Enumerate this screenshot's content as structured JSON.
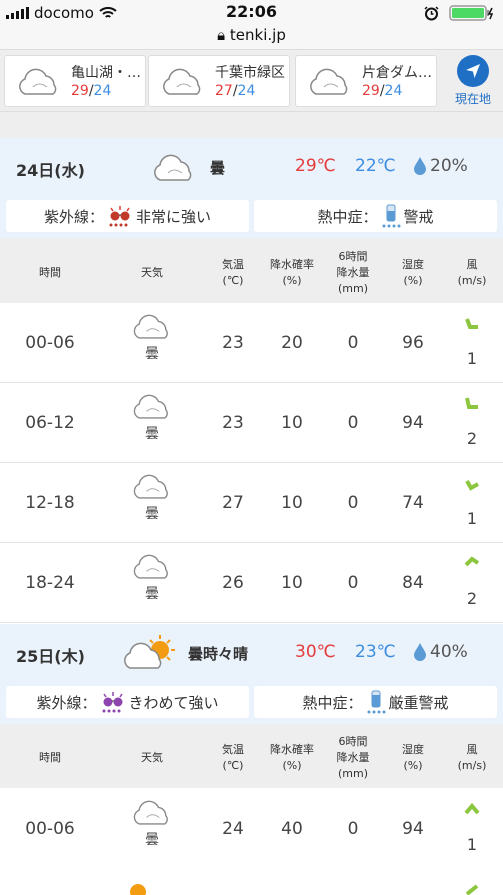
{
  "status": {
    "carrier": "docomo",
    "time": "22:06"
  },
  "address": {
    "url": "tenki.jp"
  },
  "locations": [
    {
      "name": "亀山湖・…",
      "high": "29",
      "low": "24"
    },
    {
      "name": "千葉市緑区",
      "high": "27",
      "low": "24"
    },
    {
      "name": "片倉ダム…",
      "high": "29",
      "low": "24"
    }
  ],
  "current_location_label": "現在地",
  "days": [
    {
      "date": "24日(水)",
      "weather": "曇",
      "high": "29℃",
      "low": "22℃",
      "precip": "20%",
      "uv_label": "紫外線：",
      "uv": "非常に強い",
      "heat_label": "熱中症：",
      "heat": "警戒",
      "rows": [
        {
          "time": "00-06",
          "weather": "曇",
          "temp": "23",
          "prob": "20",
          "amount": "0",
          "humidity": "96",
          "wind": "1"
        },
        {
          "time": "06-12",
          "weather": "曇",
          "temp": "23",
          "prob": "10",
          "amount": "0",
          "humidity": "94",
          "wind": "2"
        },
        {
          "time": "12-18",
          "weather": "曇",
          "temp": "27",
          "prob": "10",
          "amount": "0",
          "humidity": "74",
          "wind": "1"
        },
        {
          "time": "18-24",
          "weather": "曇",
          "temp": "26",
          "prob": "10",
          "amount": "0",
          "humidity": "84",
          "wind": "2"
        }
      ]
    },
    {
      "date": "25日(木)",
      "weather": "曇時々晴",
      "high": "30℃",
      "low": "23℃",
      "precip": "40%",
      "uv_label": "紫外線：",
      "uv": "きわめて強い",
      "heat_label": "熱中症：",
      "heat": "厳重警戒",
      "rows": [
        {
          "time": "00-06",
          "weather": "曇",
          "temp": "24",
          "prob": "40",
          "amount": "0",
          "humidity": "94",
          "wind": "1"
        }
      ]
    }
  ],
  "table_headers": {
    "time": "時間",
    "weather": "天気",
    "temp": "気温\n(℃)",
    "prob": "降水確率\n(%)",
    "amount": "6時間\n降水量\n(mm)",
    "humidity": "湿度\n(%)",
    "wind": "風\n(m/s)"
  },
  "colors": {
    "high": "#e43c3c",
    "low": "#3c8de0",
    "accent": "#1f6fc5",
    "wind_arrow": "#8cc63e"
  }
}
